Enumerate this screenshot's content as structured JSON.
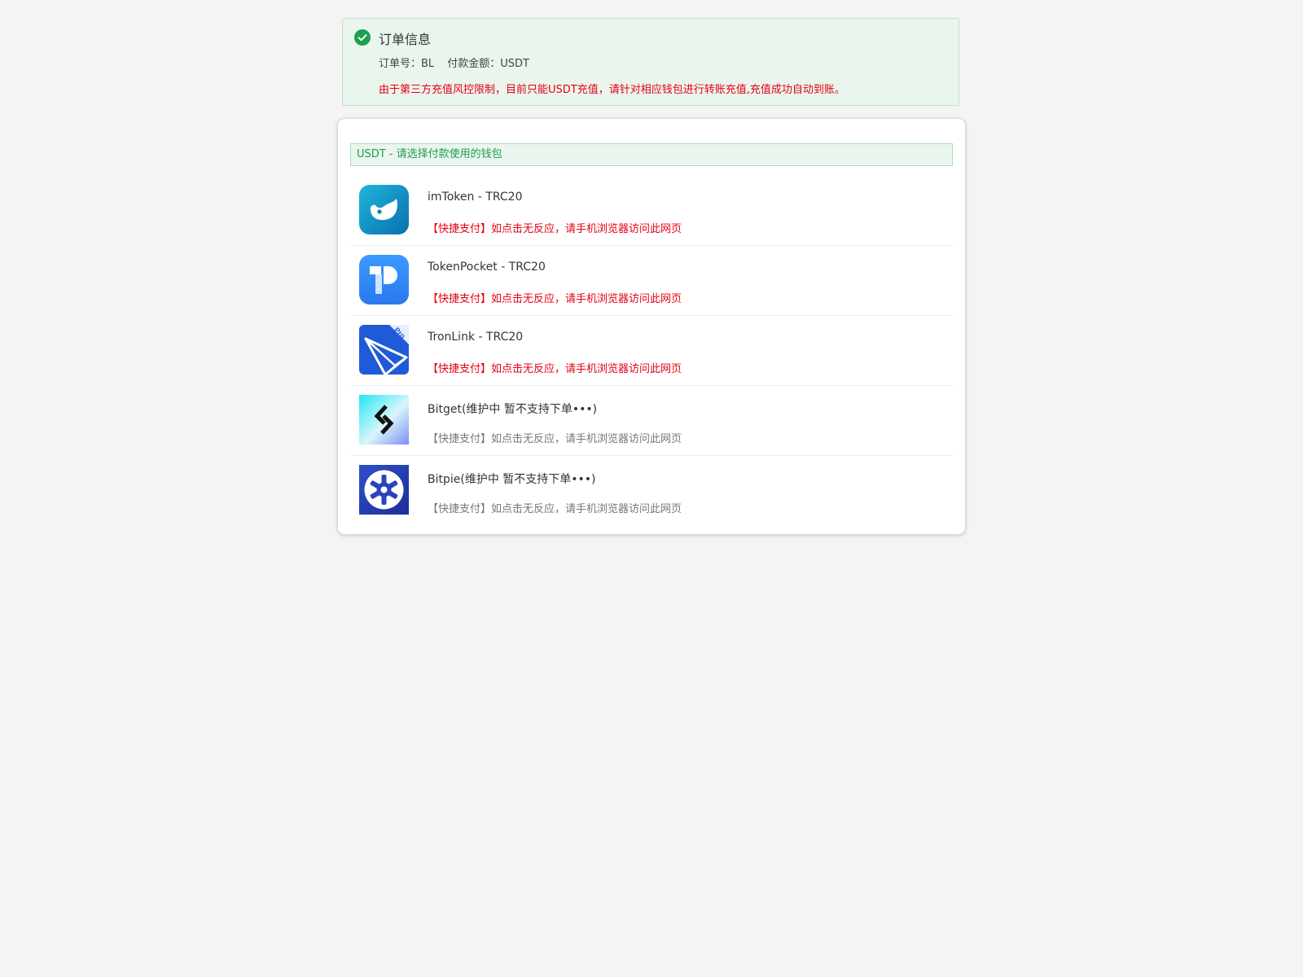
{
  "order": {
    "title": "订单信息",
    "order_no_label": "订单号：",
    "order_no_value": "BL",
    "amount_label": "付款金额：",
    "amount_value": "USDT",
    "notice": "由于第三方充值风控限制，目前只能USDT充值，请针对相应钱包进行转账充值,充值成功自动到账。",
    "status_color": "#1e9e4f",
    "notice_color": "#e60012"
  },
  "wallet_panel": {
    "header": "USDT - 请选择付款使用的钱包",
    "items": [
      {
        "name": "imToken - TRC20",
        "tip": "【快捷支付】如点击无反应，请手机浏览器访问此网页",
        "icon": "imtoken-logo",
        "state": "active"
      },
      {
        "name": "TokenPocket - TRC20",
        "tip": "【快捷支付】如点击无反应，请手机浏览器访问此网页",
        "icon": "tokenpocket-logo",
        "state": "active"
      },
      {
        "name": "TronLink - TRC20",
        "tip": "【快捷支付】如点击无反应，请手机浏览器访问此网页",
        "icon": "tronlink-logo",
        "icon_text": "Pro",
        "state": "active"
      },
      {
        "name": "Bitget(维护中 暂不支持下单•••)",
        "tip": "【快捷支付】如点击无反应，请手机浏览器访问此网页",
        "icon": "bitget-logo",
        "state": "disabled"
      },
      {
        "name": "Bitpie(维护中 暂不支持下单•••)",
        "tip": "【快捷支付】如点击无反应，请手机浏览器访问此网页",
        "icon": "bitpie-logo",
        "state": "disabled"
      }
    ]
  }
}
